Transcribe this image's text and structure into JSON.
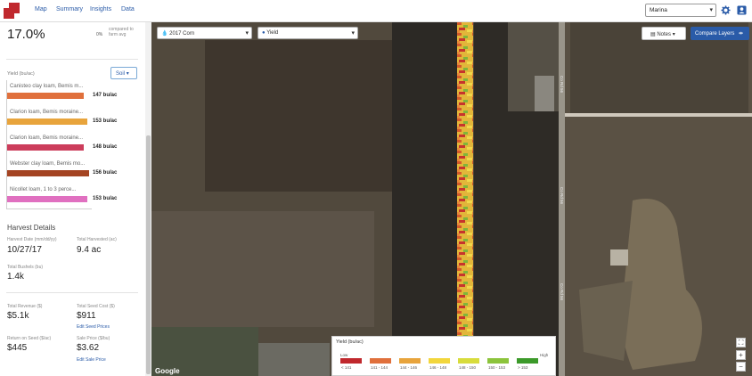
{
  "nav": {
    "links": [
      "Map",
      "Summary",
      "Insights",
      "Data"
    ],
    "user": "Marina"
  },
  "panel": {
    "percent": "17.0%",
    "percent_small": "0%",
    "percent_note": "compared to farm avg",
    "yield_label": "Yield (bu/ac)",
    "soil_button": "Soil",
    "soils": [
      {
        "name": "Canisteo clay loam, Bemis m...",
        "value": "147 bu/ac",
        "fill": 0.93,
        "color": "#e0703c"
      },
      {
        "name": "Clarion loam, Bemis moraine...",
        "value": "153 bu/ac",
        "fill": 0.98,
        "color": "#e8a43c"
      },
      {
        "name": "Clarion loam, Bemis moraine...",
        "value": "148 bu/ac",
        "fill": 0.93,
        "color": "#cc3d5b"
      },
      {
        "name": "Webster clay loam, Bemis mo...",
        "value": "156 bu/ac",
        "fill": 1.0,
        "color": "#a44422"
      },
      {
        "name": "Nicollet loam, 1 to 3 perce...",
        "value": "153 bu/ac",
        "fill": 0.98,
        "color": "#e070c0"
      }
    ],
    "harvest": {
      "title": "Harvest Details",
      "date_label": "Harvest Date (mm/dd/yy)",
      "date_value": "10/27/17",
      "area_label": "Total Harvested (ac)",
      "area_value": "9.4 ac",
      "bushels_label": "Total Bushels (bu)",
      "bushels_value": "1.4k",
      "revenue_label": "Total Revenue ($)",
      "revenue_value": "$5.1k",
      "seed_cost_label": "Total Seed Cost ($)",
      "seed_cost_value": "$911",
      "seed_cost_link": "Edit Seed Prices",
      "roi_label": "Return on Seed ($/ac)",
      "roi_value": "$445",
      "sale_label": "Sale Price ($/bu)",
      "sale_value": "$3.62",
      "sale_link": "Edit Sale Price"
    }
  },
  "map": {
    "season_dropdown": "2017 Corn",
    "layer_dropdown": "Yield",
    "notes_label": "Notes",
    "compare_label": "Compare Layers",
    "google_label": "Google",
    "road_labels": [
      "Co Rd 56",
      "Co Rd 56",
      "Co Rd 56"
    ]
  },
  "legend": {
    "title": "Yield (bu/ac)",
    "low": "Low",
    "high": "High",
    "bins": [
      {
        "label": "< 141",
        "color": "#c0282d"
      },
      {
        "label": "141 - 144",
        "color": "#e0703c"
      },
      {
        "label": "144 - 146",
        "color": "#e8a43c"
      },
      {
        "label": "146 - 148",
        "color": "#f2d63c"
      },
      {
        "label": "148 - 150",
        "color": "#d8dc3c"
      },
      {
        "label": "150 - 153",
        "color": "#8cc43c"
      },
      {
        "label": "> 153",
        "color": "#3c9a2a"
      }
    ]
  }
}
